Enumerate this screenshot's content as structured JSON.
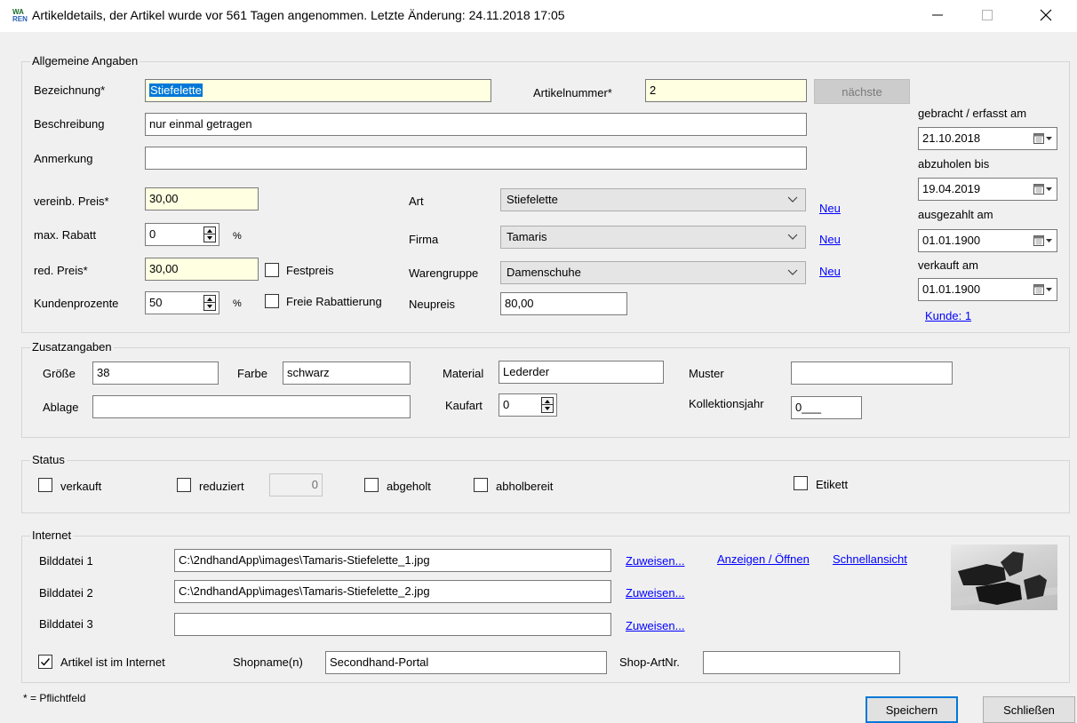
{
  "window": {
    "title": "Artikeldetails, der Artikel wurde vor 561 Tagen angenommen. Letzte Änderung: 24.11.2018 17:05",
    "icon_top": "WA",
    "icon_bottom": "REN",
    "min_icon": "minimize-icon",
    "max_icon": "maximize-icon",
    "close_icon": "close-icon"
  },
  "general": {
    "legend": "Allgemeine Angaben",
    "bezeichnung_label": "Bezeichnung*",
    "bezeichnung_value": "Stiefelette",
    "artikelnummer_label": "Artikelnummer*",
    "artikelnummer_value": "2",
    "naechste_label": "nächste",
    "beschreibung_label": "Beschreibung",
    "beschreibung_value": "nur einmal getragen",
    "anmerkung_label": "Anmerkung",
    "anmerkung_value": "",
    "preis_label": "vereinb. Preis*",
    "preis_value": "30,00",
    "rabatt_label": "max. Rabatt",
    "rabatt_value": "0",
    "rabatt_unit": "%",
    "redpreis_label": "red. Preis*",
    "redpreis_value": "30,00",
    "festpreis_label": "Festpreis",
    "kundenprozente_label": "Kundenprozente",
    "kundenprozente_value": "50",
    "kundenprozente_unit": "%",
    "freie_rabatt_label": "Freie Rabattierung",
    "art_label": "Art",
    "art_value": "Stiefelette",
    "firma_label": "Firma",
    "firma_value": "Tamaris",
    "warengruppe_label": "Warengruppe",
    "warengruppe_value": "Damenschuhe",
    "neu_label": "Neu",
    "neupreis_label": "Neupreis",
    "neupreis_value": "80,00",
    "gebracht_label": "gebracht / erfasst am",
    "gebracht_value": "21.10.2018",
    "abzuholen_label": "abzuholen bis",
    "abzuholen_value": "19.04.2019",
    "ausgezahlt_label": "ausgezahlt am",
    "ausgezahlt_value": "01.01.1900",
    "verkauft_label": "verkauft am",
    "verkauft_value": "01.01.1900",
    "kunde_link": "Kunde: 1"
  },
  "extra": {
    "legend": "Zusatzangaben",
    "groesse_label": "Größe",
    "groesse_value": "38",
    "farbe_label": "Farbe",
    "farbe_value": "schwarz",
    "material_label": "Material",
    "material_value": "Lederder",
    "muster_label": "Muster",
    "muster_value": "",
    "ablage_label": "Ablage",
    "ablage_value": "",
    "kaufart_label": "Kaufart",
    "kaufart_value": "0",
    "kollektion_label": "Kollektionsjahr",
    "kollektion_value": "0___"
  },
  "status": {
    "legend": "Status",
    "verkauft_label": "verkauft",
    "reduziert_label": "reduziert",
    "reduziert_value": "0",
    "abgeholt_label": "abgeholt",
    "abholbereit_label": "abholbereit",
    "etikett_label": "Etikett"
  },
  "internet": {
    "legend": "Internet",
    "bild1_label": "Bilddatei 1",
    "bild1_value": "C:\\2ndhandApp\\images\\Tamaris-Stiefelette_1.jpg",
    "bild2_label": "Bilddatei 2",
    "bild2_value": "C:\\2ndhandApp\\images\\Tamaris-Stiefelette_2.jpg",
    "bild3_label": "Bilddatei 3",
    "bild3_value": "",
    "zuweisen_label": "Zuweisen...",
    "anzeigen_label": "Anzeigen / Öffnen",
    "schnellansicht_label": "Schnellansicht",
    "im_internet_label": "Artikel ist im Internet",
    "im_internet_checked": true,
    "shopname_label": "Shopname(n)",
    "shopname_value": "Secondhand-Portal",
    "shopartnr_label": "Shop-ArtNr.",
    "shopartnr_value": ""
  },
  "footer": {
    "pflicht_note": "* = Pflichtfeld",
    "speichern_label": "Speichern",
    "schliessen_label": "Schließen"
  }
}
